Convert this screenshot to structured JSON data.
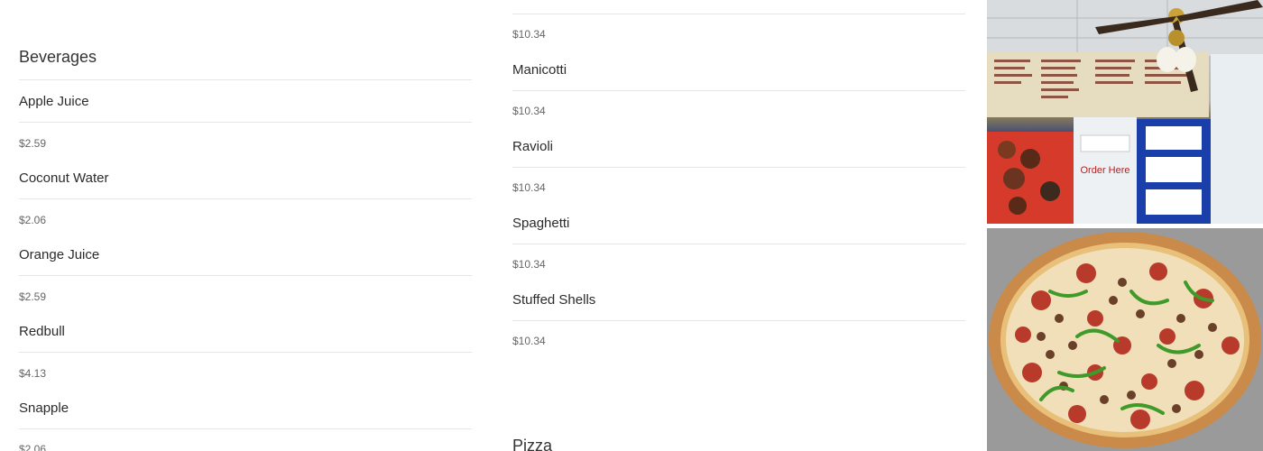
{
  "beverages": {
    "title": "Beverages",
    "items": [
      {
        "name": "Apple Juice",
        "price": "$2.59"
      },
      {
        "name": "Coconut Water",
        "price": "$2.06"
      },
      {
        "name": "Orange Juice",
        "price": "$2.59"
      },
      {
        "name": "Redbull",
        "price": "$4.13"
      },
      {
        "name": "Snapple",
        "price": "$2.06"
      }
    ]
  },
  "pasta": {
    "top_price": "$10.34",
    "items": [
      {
        "name": "Manicotti",
        "price": "$10.34"
      },
      {
        "name": "Ravioli",
        "price": "$10.34"
      },
      {
        "name": "Spaghetti",
        "price": "$10.34"
      },
      {
        "name": "Stuffed Shells",
        "price": "$10.34"
      }
    ]
  },
  "pizza": {
    "title": "Pizza"
  },
  "photos": {
    "top_icon": "restaurant-interior-photo",
    "bottom_icon": "pizza-photo",
    "menu_board_sign": "Order Here"
  }
}
